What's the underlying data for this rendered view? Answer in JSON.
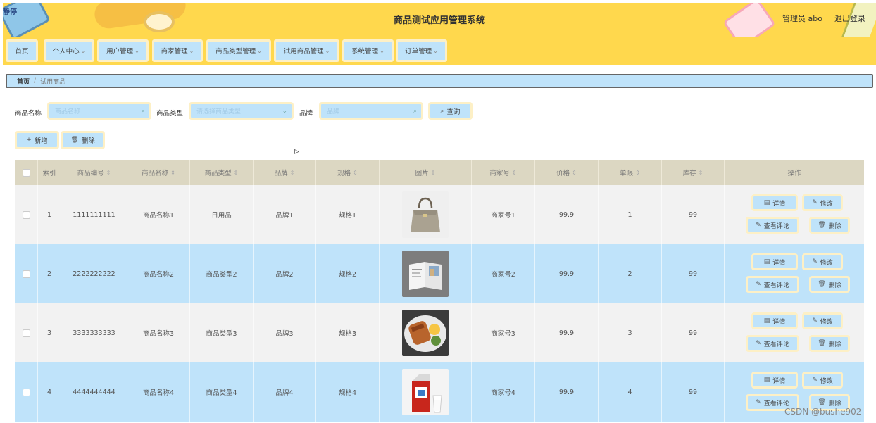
{
  "header": {
    "logo_text": "静停",
    "title": "商品测试应用管理系统",
    "admin_label": "管理员 abo",
    "logout_label": "退出登录"
  },
  "nav": {
    "items": [
      {
        "label": "首页",
        "has_dropdown": false
      },
      {
        "label": "个人中心",
        "has_dropdown": true
      },
      {
        "label": "用户管理",
        "has_dropdown": true
      },
      {
        "label": "商家管理",
        "has_dropdown": true
      },
      {
        "label": "商品类型管理",
        "has_dropdown": true
      },
      {
        "label": "试用商品管理",
        "has_dropdown": true
      },
      {
        "label": "系统管理",
        "has_dropdown": true
      },
      {
        "label": "订单管理",
        "has_dropdown": true
      }
    ],
    "chevron": "⌄"
  },
  "breadcrumb": {
    "home": "首页",
    "separator": "/",
    "current": "试用商品"
  },
  "search": {
    "name_label": "商品名称",
    "name_placeholder": "商品名称",
    "type_label": "商品类型",
    "type_placeholder": "请选择商品类型",
    "brand_label": "品牌",
    "brand_placeholder": "品牌",
    "query_label": "查询"
  },
  "actions": {
    "add_label": "新增",
    "delete_label": "删除"
  },
  "table": {
    "columns": [
      "",
      "索引",
      "商品编号",
      "商品名称",
      "商品类型",
      "品牌",
      "规格",
      "图片",
      "商家号",
      "价格",
      "单限",
      "库存",
      "操作"
    ],
    "sortable": [
      false,
      false,
      true,
      true,
      true,
      true,
      true,
      true,
      true,
      true,
      true,
      true,
      false
    ],
    "rows": [
      {
        "index": "1",
        "code": "1111111111",
        "name": "商品名称1",
        "type": "日用品",
        "brand": "品牌1",
        "spec": "规格1",
        "image": "handbag",
        "merchant": "商家号1",
        "price": "99.9",
        "limit": "1",
        "stock": "99"
      },
      {
        "index": "2",
        "code": "2222222222",
        "name": "商品名称2",
        "type": "商品类型2",
        "brand": "品牌2",
        "spec": "规格2",
        "image": "brochure",
        "merchant": "商家号2",
        "price": "99.9",
        "limit": "2",
        "stock": "99"
      },
      {
        "index": "3",
        "code": "3333333333",
        "name": "商品名称3",
        "type": "商品类型3",
        "brand": "品牌3",
        "spec": "规格3",
        "image": "food-plate",
        "merchant": "商家号3",
        "price": "99.9",
        "limit": "3",
        "stock": "99"
      },
      {
        "index": "4",
        "code": "4444444444",
        "name": "商品名称4",
        "type": "商品类型4",
        "brand": "品牌4",
        "spec": "规格4",
        "image": "milk-carton",
        "merchant": "商家号4",
        "price": "99.9",
        "limit": "4",
        "stock": "99"
      }
    ],
    "row_actions": {
      "detail": "详情",
      "edit": "修改",
      "view_comments": "查看评论",
      "delete": "删除"
    }
  },
  "watermark": "CSDN @bushe902",
  "colors": {
    "header_bg": "#ffd84d",
    "button_bg": "#bfe3fa",
    "button_border": "#fdf0c6",
    "table_header_bg": "#dcd7c2",
    "row_alt_bg": "#bfe3fa"
  }
}
